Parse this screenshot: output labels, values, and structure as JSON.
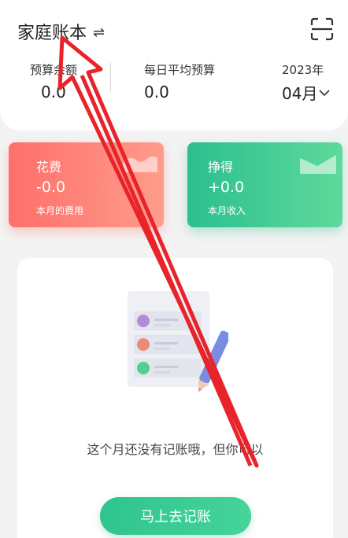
{
  "header": {
    "book_title": "家庭账本",
    "switch_icon": "⇌",
    "scan_icon": "scan-icon"
  },
  "stats": {
    "balance_label": "预算余额",
    "balance_value": "0.0",
    "avg_label": "每日平均预算",
    "avg_value": "0.0",
    "year": "2023年",
    "month": "04月"
  },
  "cards": {
    "expense": {
      "title": "花费",
      "amount": "-0.0",
      "subtitle": "本月的费用"
    },
    "income": {
      "title": "挣得",
      "amount": "+0.0",
      "subtitle": "本月收入"
    }
  },
  "empty_state": {
    "message": "这个月还没有记账哦，但你可以",
    "button_label": "马上去记账"
  },
  "colors": {
    "expense": "#ff7a72",
    "income": "#33c48f",
    "annotation_arrow": "#e8232a"
  }
}
